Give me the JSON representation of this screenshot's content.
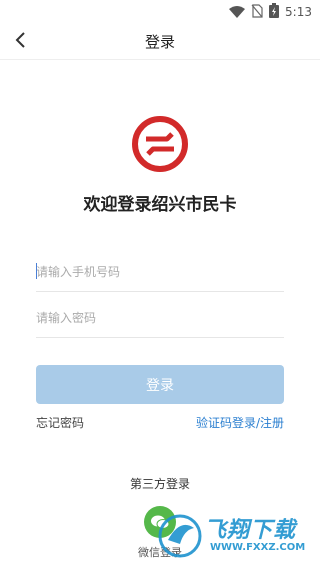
{
  "status_bar": {
    "time": "5:13"
  },
  "nav": {
    "title": "登录"
  },
  "welcome": {
    "title": "欢迎登录绍兴市民卡"
  },
  "form": {
    "phone_placeholder": "请输入手机号码",
    "password_placeholder": "请输入密码",
    "login_label": "登录"
  },
  "links": {
    "forgot_password": "忘记密码",
    "sms_login_register": "验证码登录/注册"
  },
  "third_party": {
    "title": "第三方登录",
    "wechat_label": "微信登录"
  },
  "watermark": {
    "brand": "飞翔下载",
    "url": "WWW.FXXZ.COM"
  },
  "colors": {
    "accent_link": "#2b7fd0",
    "login_button_disabled": "#a9cbe8",
    "logo_red": "#d22a2a",
    "wechat_green": "#55b84a"
  },
  "icons": [
    "wifi-icon",
    "no-sim-icon",
    "battery-charging-icon",
    "back-arrow-icon",
    "shaoxing-card-logo",
    "wechat-icon"
  ]
}
